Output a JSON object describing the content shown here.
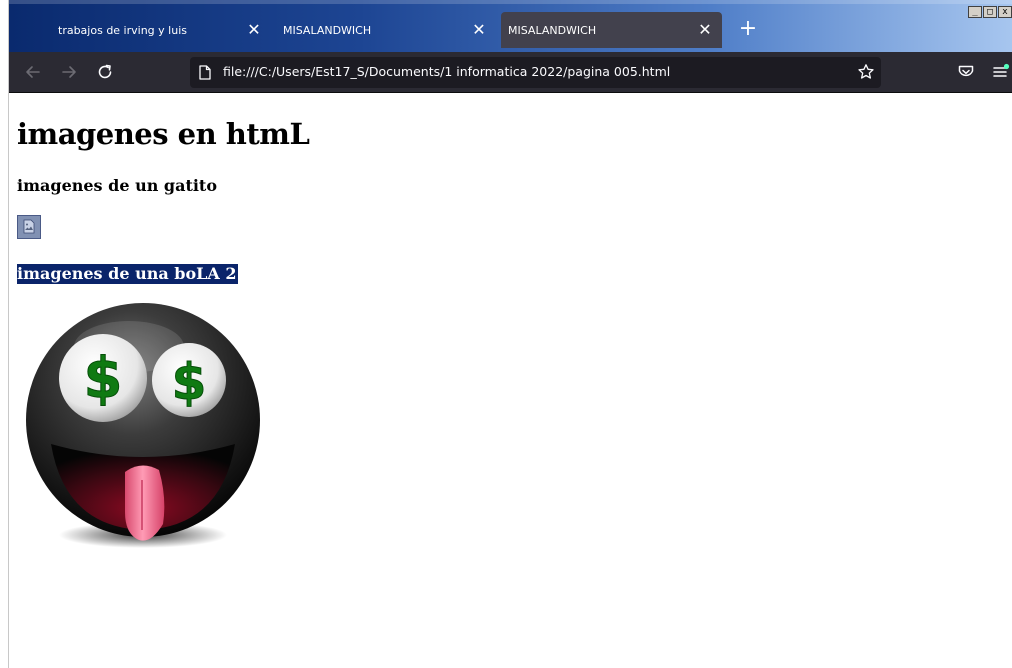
{
  "browser": {
    "tabs": [
      {
        "title": "trabajos de irving y luis",
        "active": false
      },
      {
        "title": "MISALANDWICH",
        "active": false
      },
      {
        "title": "MISALANDWICH",
        "active": true
      }
    ],
    "url": "file:///C:/Users/Est17_S/Documents/1 informatica 2022/pagina 005.html",
    "window_buttons": [
      "_",
      "□",
      "x"
    ]
  },
  "page": {
    "heading": "imagenes en htmL",
    "subheading_cat": "imagenes de un gatito",
    "subheading_ball": "imagenes de una boLA 2",
    "ball_eye_symbol": "$"
  },
  "colors": {
    "selection_bg": "#0a246a",
    "toolbar_bg": "#2b2a33",
    "urlbar_bg": "#1c1b22",
    "active_tab_bg": "#42414d",
    "pocket_dot": "#54ffbd"
  }
}
